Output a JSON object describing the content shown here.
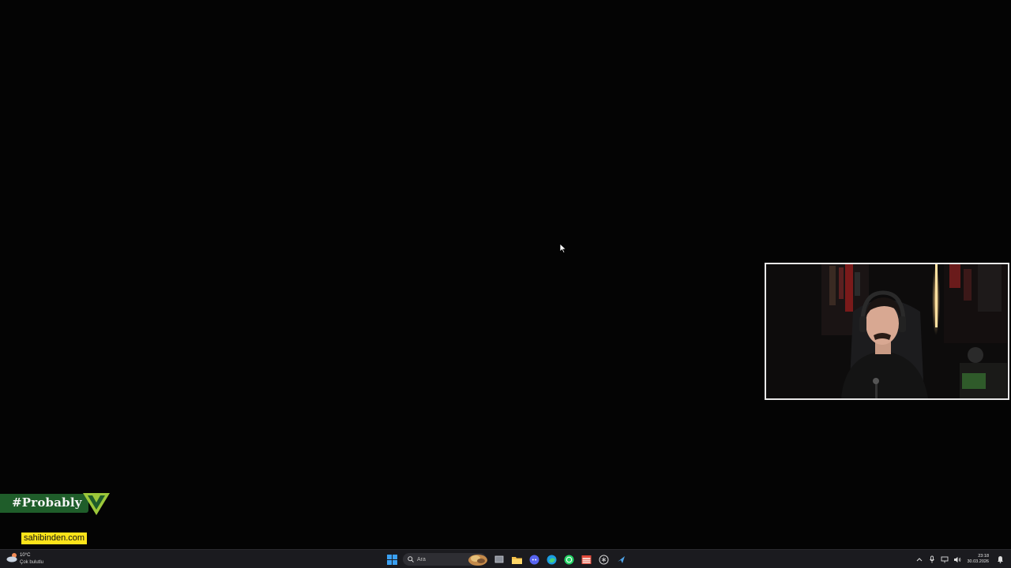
{
  "overlay": {
    "probably_text": "#Probably",
    "sponsor_text": "sahibinden.com"
  },
  "taskbar": {
    "weather": {
      "temperature": "10°C",
      "condition": "Çok bulutlu"
    },
    "search_placeholder": "Ara",
    "apps": [
      "start-icon",
      "search-icon",
      "task-view-icon",
      "file-explorer-icon",
      "discord-icon",
      "edge-icon",
      "whatsapp-icon",
      "calendar-app-icon",
      "chatgpt-icon",
      "steam-icon"
    ],
    "clock": {
      "time": "23:18",
      "date": "30.03.2026"
    }
  },
  "colors": {
    "taskbar_bg": "#1b1b1f",
    "banner_green": "#1f5d2a",
    "logo_lime": "#9cc83a",
    "sponsor_yellow": "#fbe31a"
  }
}
